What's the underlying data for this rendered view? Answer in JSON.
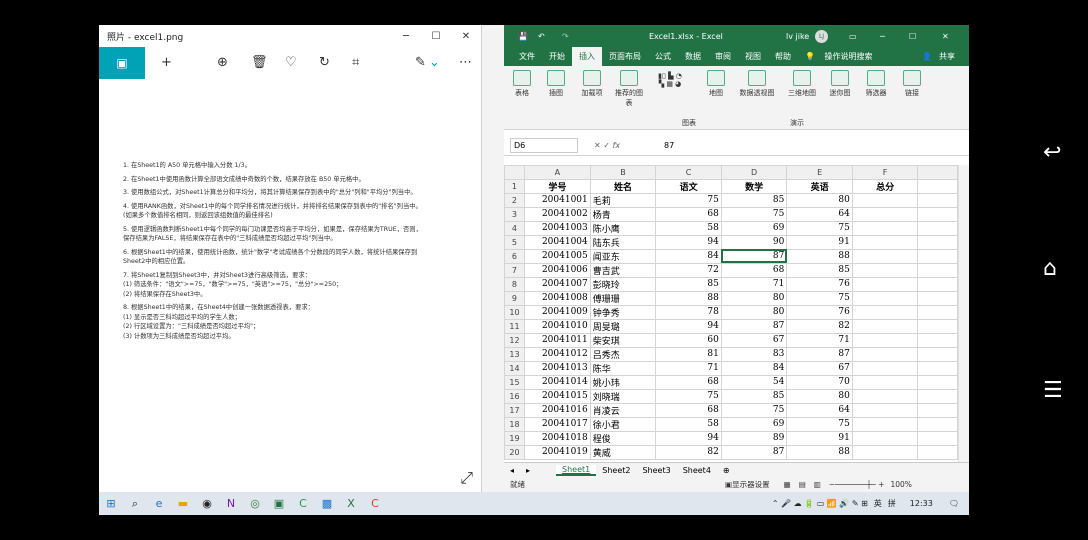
{
  "photos": {
    "title": "照片 - excel1.png",
    "instructions": [
      "1. 在Sheet1的 A50 单元格中输入分数 1/3。",
      "2. 在Sheet1中使用函数计算全部语文成绩中奇数的个数，结果存放在 B50 单元格中。",
      "3. 使用数组公式，对Sheet1计算总分和平均分，将其计算结果保存到表中的\"总分\"列和\"平均分\"列当中。",
      "4. 使用RANK函数，对Sheet1中的每个同学排名情况进行统计，并将排名结果保存到表中的\"排名\"列当中。\n(如果多个数值排名相同，则返回该组数值的最佳排名)",
      "5. 使用逻辑函数判断Sheet1中每个同学的每门功课是否均高于平均分，如果是，保存结果为TRUE，否则，\n保存结果为FALSE，将结果保存在表中的\"三科成绩是否均超过平均\"列当中。",
      "6. 根据Sheet1中的结果，使用统计函数，统计\"数学\"考试成绩各个分数段的同学人数，将统计结果保存到\nSheet2中的相应位置。",
      "7. 将Sheet1复制到Sheet3中，并对Sheet3进行高级筛选，要求：\n(1) 筛选条件：\"语文\">=75，\"数学\">=75，\"英语\">=75，\"总分\">=250；\n(2) 将结果保存在Sheet3中。",
      "8. 根据Sheet1中的结果，在Sheet4中创建一张数据透视表，要求：\n(1) 显示是否三科均超过平均的学生人数；\n(2) 行区域设置为：\"三科成绩是否均超过平均\"；\n(3) 计数项为三科成绩是否均超过平均。"
    ]
  },
  "excel": {
    "title": "Excel1.xlsx - Excel",
    "user": "lv jike",
    "user_initials": "LJ",
    "tabs": [
      "文件",
      "开始",
      "插入",
      "页面布局",
      "公式",
      "数据",
      "审阅",
      "视图",
      "帮助"
    ],
    "tell_me": "操作说明搜索",
    "share": "共享",
    "ribbon": {
      "tables": "表格",
      "illustrations": "插图",
      "addins": "加载项",
      "rec_charts": "推荐的图表",
      "map": "地图",
      "pivotchart": "数据透视图",
      "3dmap": "三维地图",
      "sparklines": "迷你图",
      "filter": "筛选器",
      "link": "链接",
      "group_charts": "图表",
      "group_tours": "演示"
    },
    "namebox": "D6",
    "formula_value": "87",
    "col_letters": [
      "A",
      "B",
      "C",
      "D",
      "E",
      "F"
    ],
    "headers": [
      "学号",
      "姓名",
      "语文",
      "数学",
      "英语",
      "总分"
    ],
    "rows": [
      [
        "20041001",
        "毛莉",
        "75",
        "85",
        "80"
      ],
      [
        "20041002",
        "杨青",
        "68",
        "75",
        "64"
      ],
      [
        "20041003",
        "陈小鹰",
        "58",
        "69",
        "75"
      ],
      [
        "20041004",
        "陆东兵",
        "94",
        "90",
        "91"
      ],
      [
        "20041005",
        "闻亚东",
        "84",
        "87",
        "88"
      ],
      [
        "20041006",
        "曹吉武",
        "72",
        "68",
        "85"
      ],
      [
        "20041007",
        "彭晓玲",
        "85",
        "71",
        "76"
      ],
      [
        "20041008",
        "傅珊珊",
        "88",
        "80",
        "75"
      ],
      [
        "20041009",
        "钟争秀",
        "78",
        "80",
        "76"
      ],
      [
        "20041010",
        "周旻璐",
        "94",
        "87",
        "82"
      ],
      [
        "20041011",
        "柴安琪",
        "60",
        "67",
        "71"
      ],
      [
        "20041012",
        "吕秀杰",
        "81",
        "83",
        "87"
      ],
      [
        "20041013",
        "陈华",
        "71",
        "84",
        "67"
      ],
      [
        "20041014",
        "姚小玮",
        "68",
        "54",
        "70"
      ],
      [
        "20041015",
        "刘晓瑞",
        "75",
        "85",
        "80"
      ],
      [
        "20041016",
        "肖凌云",
        "68",
        "75",
        "64"
      ],
      [
        "20041017",
        "徐小君",
        "58",
        "69",
        "75"
      ],
      [
        "20041018",
        "程俊",
        "94",
        "89",
        "91"
      ],
      [
        "20041019",
        "黄威",
        "82",
        "87",
        "88"
      ]
    ],
    "sheets": [
      "Sheet1",
      "Sheet2",
      "Sheet3",
      "Sheet4"
    ],
    "status_ready": "就绪",
    "display_settings": "显示器设置",
    "zoom": "100%"
  },
  "taskbar": {
    "time": "12:33",
    "ime": "英",
    "ime2": "拼"
  }
}
